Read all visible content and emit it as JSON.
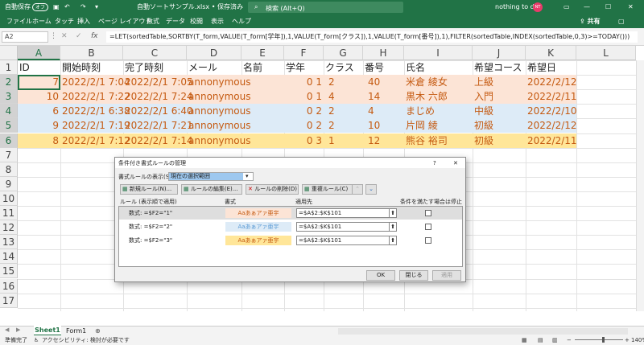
{
  "title": {
    "autosave": "自動保存",
    "autosave_state": "オフ",
    "filename": "自動ソートサンプル.xlsx • 保存済み",
    "search": "検索 (Alt+Q)",
    "account": "nothing to do",
    "avatar": "NT"
  },
  "menu": {
    "items": [
      "ファイル",
      "ホーム",
      "タッチ",
      "挿入",
      "ページ レイアウト",
      "数式",
      "データ",
      "校閲",
      "表示",
      "ヘルプ"
    ],
    "share": "共有"
  },
  "formula_bar": {
    "name_box": "A2",
    "fx": "fx",
    "formula": "=LET(sortedTable,SORTBY(T_form,VALUE(T_form[学年]),1,VALUE(T_form[クラス]),1,VALUE(T_form[番号]),1),FILTER(sortedTable,INDEX(sortedTable,0,3)>=TODAY()))"
  },
  "columns": [
    "A",
    "B",
    "C",
    "D",
    "E",
    "F",
    "G",
    "H",
    "I",
    "J",
    "K",
    "L"
  ],
  "rows": [
    "1",
    "2",
    "3",
    "4",
    "5",
    "6",
    "7",
    "8",
    "9",
    "10",
    "11",
    "12",
    "13",
    "14",
    "15",
    "16",
    "17"
  ],
  "header_row": [
    "ID",
    "開始時刻",
    "完了時刻",
    "メール",
    "名前",
    "学年",
    "クラス",
    "番号",
    "氏名",
    "希望コース",
    "希望日"
  ],
  "data_rows": [
    {
      "fill": "#fce4d6",
      "cells": [
        "7",
        "2022/2/1 7:04",
        "2022/2/1 7:05",
        "annonymous",
        "",
        "0 1",
        "2",
        "40",
        "米倉 綾女",
        "上級",
        "2022/2/12"
      ]
    },
    {
      "fill": "#fce4d6",
      "cells": [
        "10",
        "2022/2/1 7:22",
        "2022/2/1 7:24",
        "annonymous",
        "",
        "0 1",
        "4",
        "14",
        "黒木 六郎",
        "入門",
        "2022/2/11"
      ]
    },
    {
      "fill": "#ddebf7",
      "cells": [
        "6",
        "2022/2/1 6:38",
        "2022/2/1 6:40",
        "annonymous",
        "",
        "0 2",
        "2",
        "4",
        "まじめ",
        "中級",
        "2022/2/10"
      ]
    },
    {
      "fill": "#ddebf7",
      "cells": [
        "9",
        "2022/2/1 7:19",
        "2022/2/1 7:21",
        "annonymous",
        "",
        "0 2",
        "2",
        "10",
        "片岡 綾",
        "初級",
        "2022/2/12"
      ]
    },
    {
      "fill": "#ffe699",
      "cells": [
        "8",
        "2022/2/1 7:12",
        "2022/2/1 7:14",
        "annonymous",
        "",
        "0 3",
        "1",
        "12",
        "熊谷 裕司",
        "初級",
        "2022/2/11"
      ]
    }
  ],
  "text_color": "#c55a11",
  "dialog": {
    "title": "条件付き書式ルールの管理",
    "show_rules_label": "書式ルールの表示(S):",
    "show_rules_value": "現在の選択範囲",
    "new_rule": "新規ルール(N)...",
    "edit_rule": "ルールの編集(E)...",
    "delete_rule": "ルールの削除(D)",
    "duplicate_rule": "重複ルール(C)",
    "col_rule": "ルール (表示順で適用)",
    "col_format": "書式",
    "col_applies": "適用先",
    "col_stop": "条件を満たす場合は停止",
    "rules": [
      {
        "rule": "数式: =$F2=\"1\"",
        "sample": "Aaあぁアァ亜宇",
        "fill": "#fce4d6",
        "color": "#c55a11",
        "applies": "=$A$2:$K$101"
      },
      {
        "rule": "数式: =$F2=\"2\"",
        "sample": "Aaあぁアァ亜宇",
        "fill": "#ddebf7",
        "color": "#5b9bd5",
        "applies": "=$A$2:$K$101"
      },
      {
        "rule": "数式: =$F2=\"3\"",
        "sample": "Aaあぁアァ亜宇",
        "fill": "#ffe699",
        "color": "#c55a11",
        "applies": "=$A$2:$K$101"
      }
    ],
    "ok": "OK",
    "close": "閉じる",
    "apply": "適用"
  },
  "sheets": [
    "Sheet1",
    "Form1"
  ],
  "status": {
    "ready": "準備完了",
    "accessibility": "アクセシビリティ: 検討が必要です",
    "zoom": "140%"
  }
}
